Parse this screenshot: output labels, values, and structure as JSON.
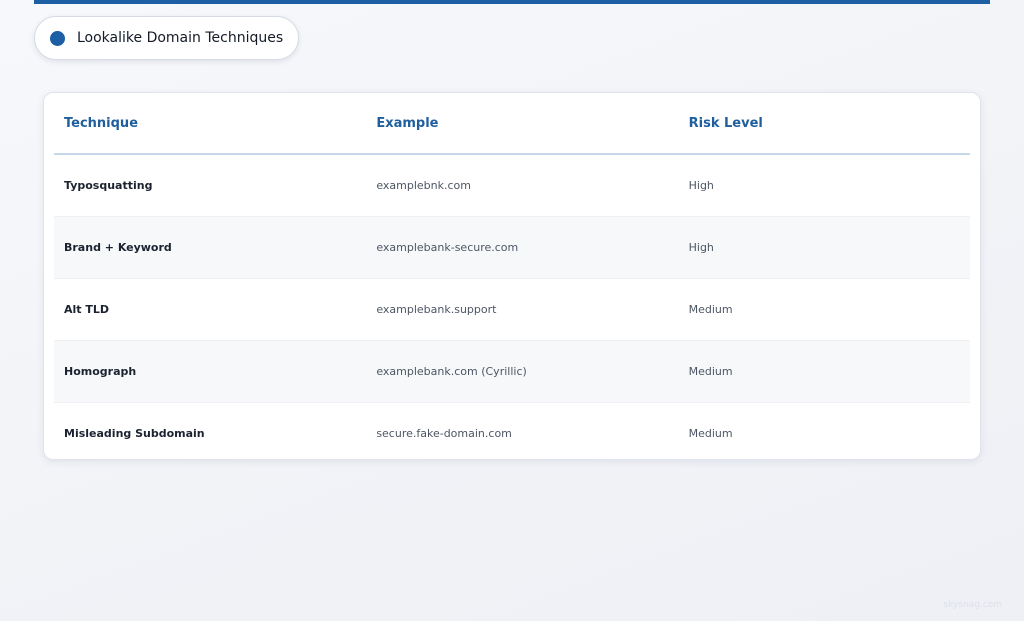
{
  "header": {
    "title": "Lookalike Domain Techniques"
  },
  "table": {
    "columns": [
      "Technique",
      "Example",
      "Risk Level"
    ],
    "rows": [
      {
        "technique": "Typosquatting",
        "example": "examplebnk.com",
        "risk": "High"
      },
      {
        "technique": "Brand + Keyword",
        "example": "examplebank-secure.com",
        "risk": "High"
      },
      {
        "technique": "Alt TLD",
        "example": "examplebank.support",
        "risk": "Medium"
      },
      {
        "technique": "Homograph",
        "example": "examplebank.com (Cyrillic)",
        "risk": "Medium"
      },
      {
        "technique": "Misleading Subdomain",
        "example": "secure.fake-domain.com",
        "risk": "Medium"
      }
    ]
  },
  "footer": {
    "watermark": "skysnag.com"
  },
  "colors": {
    "accent": "#1c5fa5",
    "header_text": "#1f5f9e"
  }
}
